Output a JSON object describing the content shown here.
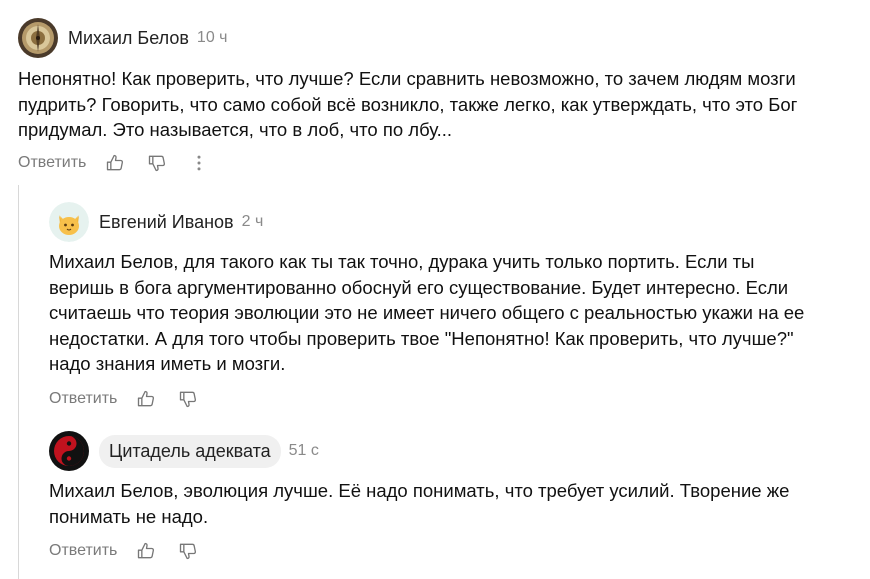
{
  "comments": [
    {
      "author": "Михаил Белов",
      "time": "10 ч",
      "text": "Непонятно! Как проверить, что лучше? Если сравнить невозможно, то зачем людям мозги пудрить? Говорить, что само собой всё возникло, также легко, как утверждать, что это Бог придумал. Это называется, что в лоб, что по лбу...",
      "reply_label": "Ответить",
      "avatar_icon": "astronomical-clock-avatar"
    },
    {
      "author": "Евгений Иванов",
      "time": "2 ч",
      "text": "Михаил Белов, для такого как ты так точно, дурака учить только портить. Если ты веришь в бога аргументированно обоснуй его существование. Будет интересно. Если считаешь что теория эволюции это не имеет ничего общего с реальностью укажи на ее недостатки. А для того чтобы проверить твое \"Непонятно! Как проверить, что лучше?\" надо знания иметь и мозги.",
      "reply_label": "Ответить",
      "avatar_icon": "cat-emoji-avatar"
    },
    {
      "author": "Цитадель адеквата",
      "time": "51 с",
      "text": "Михаил Белов, эволюция лучше. Её надо понимать, что требует усилий. Творение же понимать не надо.",
      "reply_label": "Ответить",
      "avatar_icon": "red-yin-yang-avatar"
    }
  ],
  "colors": {
    "meta_gray": "#8a8a8a",
    "reply_gray": "#7a7a7a",
    "text": "#111111",
    "pill_bg": "#f0f0f0",
    "thread_line": "#d8d8d8"
  }
}
